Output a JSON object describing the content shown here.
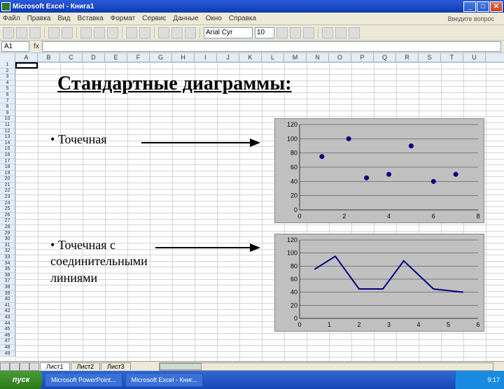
{
  "window": {
    "title": "Microsoft Excel - Книга1",
    "min": "_",
    "max": "□",
    "close": "✕"
  },
  "menu": [
    "Файл",
    "Правка",
    "Вид",
    "Вставка",
    "Формат",
    "Сервис",
    "Данные",
    "Окно",
    "Справка"
  ],
  "ask": "Введите вопрос",
  "font": {
    "name": "Arial Cyr",
    "size": "10"
  },
  "namebox": "A1",
  "fx": "fx",
  "cols": [
    "A",
    "B",
    "C",
    "D",
    "E",
    "F",
    "G",
    "H",
    "I",
    "J",
    "K",
    "L",
    "M",
    "N",
    "O",
    "P",
    "Q",
    "R",
    "S",
    "T",
    "U"
  ],
  "rows": [
    "1",
    "2",
    "3",
    "4",
    "5",
    "6",
    "7",
    "8",
    "9",
    "10",
    "11",
    "12",
    "13",
    "14",
    "15",
    "16",
    "17",
    "18",
    "19",
    "20",
    "21",
    "22",
    "23",
    "24",
    "25",
    "26",
    "27",
    "28",
    "29",
    "30",
    "31",
    "32",
    "33",
    "34",
    "35",
    "36",
    "37",
    "38",
    "39",
    "40",
    "41",
    "42",
    "43",
    "44",
    "45",
    "46",
    "47",
    "48",
    "49"
  ],
  "slide": {
    "title": "Стандартные диаграммы:",
    "bullet1": "Точечная",
    "bullet2": "Точечная с\nсоединительными\nлиниями"
  },
  "sheets": {
    "active": "Лист1",
    "others": [
      "Лист2",
      "Лист3"
    ]
  },
  "taskbar": {
    "start": "пуск",
    "items": [
      "",
      "",
      "Microsoft PowerPoint...",
      "Microsoft Excel - Книг..."
    ],
    "clock": "9:17"
  },
  "chart_data": [
    {
      "type": "scatter",
      "title": "",
      "xlabel": "",
      "ylabel": "",
      "xlim": [
        0,
        8
      ],
      "ylim": [
        0,
        120
      ],
      "xticks": [
        0,
        2,
        4,
        6,
        8
      ],
      "yticks": [
        0,
        20,
        40,
        60,
        80,
        100,
        120
      ],
      "points": [
        {
          "x": 1.0,
          "y": 75
        },
        {
          "x": 2.2,
          "y": 100
        },
        {
          "x": 3.0,
          "y": 45
        },
        {
          "x": 4.0,
          "y": 50
        },
        {
          "x": 5.0,
          "y": 90
        },
        {
          "x": 6.0,
          "y": 40
        },
        {
          "x": 7.0,
          "y": 50
        }
      ]
    },
    {
      "type": "line",
      "title": "",
      "xlabel": "",
      "ylabel": "",
      "xlim": [
        0,
        6
      ],
      "ylim": [
        0,
        120
      ],
      "xticks": [
        0,
        1,
        2,
        3,
        4,
        5,
        6
      ],
      "yticks": [
        0,
        20,
        40,
        60,
        80,
        100,
        120
      ],
      "points": [
        {
          "x": 0.5,
          "y": 75
        },
        {
          "x": 1.2,
          "y": 95
        },
        {
          "x": 2.0,
          "y": 45
        },
        {
          "x": 2.8,
          "y": 45
        },
        {
          "x": 3.5,
          "y": 88
        },
        {
          "x": 4.5,
          "y": 45
        },
        {
          "x": 5.5,
          "y": 40
        }
      ]
    }
  ]
}
